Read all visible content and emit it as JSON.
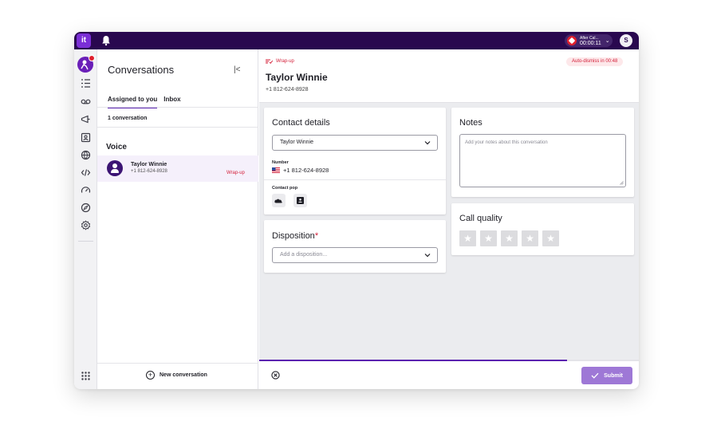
{
  "topbar": {
    "logo_text": "it",
    "after_call_label": "After Cal...",
    "after_call_timer": "00:00:11",
    "user_initial": "S"
  },
  "conversations": {
    "title": "Conversations",
    "tabs": [
      {
        "label": "Assigned to you",
        "active": true
      },
      {
        "label": "Inbox",
        "active": false
      }
    ],
    "count_label": "1 conversation",
    "section_label": "Voice",
    "items": [
      {
        "name": "Taylor Winnie",
        "phone": "+1 812-624-8928",
        "status": "Wrap-up"
      }
    ],
    "new_conversation_label": "New conversation"
  },
  "detail": {
    "status_tag": "Wrap-up",
    "auto_dismiss": "Auto-dismiss in 00:48",
    "contact_name": "Taylor Winnie",
    "contact_phone": "+1 812-624-8928",
    "contact_card": {
      "title": "Contact details",
      "selected_contact": "Taylor Winnie",
      "number_label": "Number",
      "number_value": "+1 812-624-8928",
      "contact_pop_label": "Contact pop"
    },
    "disposition_card": {
      "title": "Disposition",
      "required_mark": "*",
      "placeholder": "Add a disposition..."
    },
    "notes_card": {
      "title": "Notes",
      "placeholder": "Add your notes about this conversation"
    },
    "call_quality_card": {
      "title": "Call quality",
      "rating": 0,
      "max_rating": 5
    },
    "progress_fraction": 0.81,
    "submit_label": "Submit"
  },
  "colors": {
    "topbar": "#29084f",
    "accent": "#5a22b0",
    "submit": "#9e78d6",
    "wrapup_red": "#d4203a"
  }
}
